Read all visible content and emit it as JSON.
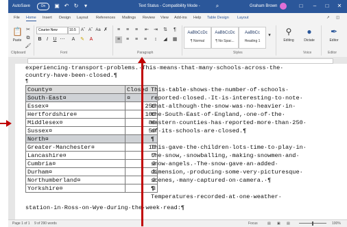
{
  "titlebar": {
    "autosave": "AutoSave",
    "autosave_state": "On",
    "doc_title": "Text Status  -  Compatibility Mode  -",
    "search": "⌕",
    "user": "Graham Brown",
    "qa_icons": [
      "save-icon",
      "undo-icon",
      "redo-icon",
      "quick-access-more-icon"
    ],
    "window_icons": [
      "minimize-icon",
      "restore-icon",
      "close-icon"
    ]
  },
  "tabs": [
    "File",
    "Home",
    "Insert",
    "Design",
    "Layout",
    "References",
    "Mailings",
    "Review",
    "View",
    "Add-ins",
    "Help",
    "Table Design",
    "Layout"
  ],
  "ribbon": {
    "groups": [
      "Clipboard",
      "Font",
      "Paragraph",
      "Styles",
      "Voice",
      "Editor"
    ],
    "paste": "Paste",
    "font_name": "Courier New",
    "font_size": "10.5",
    "styles": [
      {
        "preview": "AaBbCcDc",
        "name": "¶ Normal"
      },
      {
        "preview": "AaBbCcDc",
        "name": "¶ No Spac..."
      },
      {
        "preview": "AaBbCc",
        "name": "Heading 1"
      }
    ],
    "editing": "Editing",
    "dictate": "Dictate",
    "editor": "Editor"
  },
  "document": {
    "line1": "experiencing·transport·problems.·This·means·that·many·schools·across·the·",
    "line2": "country·have·been·closed.¶",
    "line3": "¶",
    "table": {
      "headers": [
        "County¤",
        "Closed"
      ],
      "rows": [
        {
          "county": "South·East¤",
          "closed": "¤",
          "shaded": true
        },
        {
          "county": "Essex¤",
          "closed": "250",
          "shaded": false
        },
        {
          "county": "Hertfordshire¤",
          "closed": "100",
          "shaded": false
        },
        {
          "county": "Middlesex¤",
          "closed": "80",
          "shaded": false
        },
        {
          "county": "Sussex¤",
          "closed": "50",
          "shaded": false
        },
        {
          "county": "North¤",
          "closed": "",
          "shaded": true
        },
        {
          "county": "Greater·Manchester¤",
          "closed": "10",
          "shaded": false
        },
        {
          "county": "Lancashire¤",
          "closed": "7",
          "shaded": false
        },
        {
          "county": "Cumbria¤",
          "closed": "3",
          "shaded": false
        },
        {
          "county": "Durham¤",
          "closed": "3",
          "shaded": false
        },
        {
          "county": "Northumberland¤",
          "closed": "3",
          "shaded": false
        },
        {
          "county": "Yorkshire¤",
          "closed": "3",
          "shaded": false
        }
      ]
    },
    "right": [
      "This·table·shows·the·number·of·schools·",
      "reported·closed.·It·is·interesting·to·note·",
      "that·although·the·snow·was·no·heavier·in·",
      "the·South·East·of·England,·one·of·the·",
      "eastern·counties·has·reported·more·than·250·",
      "of·its·schools·are·closed.¶",
      "¶",
      "This·gave·the·children·lots·time·to·play·in·",
      "the·snow,·snowballing,·making·snowmen·and·",
      "snow·angels.·The·snow·gave·an·added·",
      "dimension,·producing·some·very·picturesque·",
      "scenes,·many·captured·on·camera.·¶",
      "¶",
      "Temperatures·recorded·at·one·weather·"
    ],
    "bottom": "station·in·Ross-on-Wye·during·the·week·read:¶"
  },
  "statusbar": {
    "page": "Page 1 of 1",
    "words": "9 of 290 words",
    "focus": "Focus",
    "zoom": "100%"
  }
}
